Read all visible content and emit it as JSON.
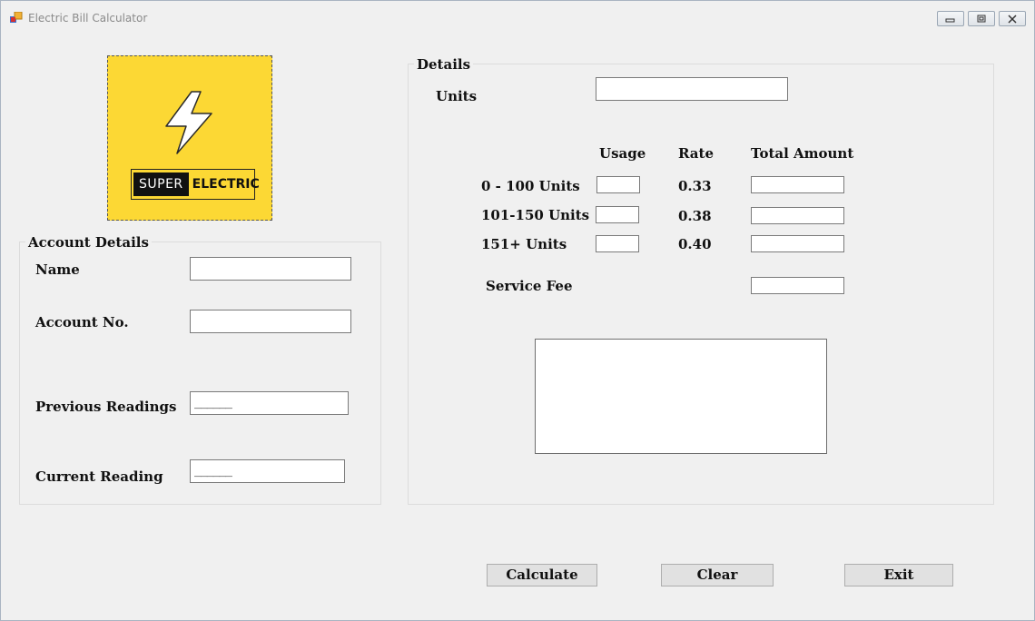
{
  "window": {
    "title": "Electric Bill Calculator"
  },
  "logo": {
    "word1": "SUPER",
    "word2": "ELECTRIC",
    "colors": {
      "background": "#fcd834",
      "badge": "#111111"
    }
  },
  "account": {
    "group_title": "Account Details",
    "name_label": "Name",
    "name_value": "",
    "account_label": "Account No.",
    "account_value": "",
    "previous_label": "Previous Readings",
    "previous_mask": "______",
    "current_label": "Current Reading",
    "current_mask": "______"
  },
  "details": {
    "group_title": "Details",
    "units_label": "Units",
    "units_value": "",
    "headers": {
      "usage": "Usage",
      "rate": "Rate",
      "total": "Total Amount"
    },
    "tiers": [
      {
        "label": "0 - 100 Units",
        "rate": "0.33",
        "usage": "",
        "total": ""
      },
      {
        "label": "101-150 Units",
        "rate": "0.38",
        "usage": "",
        "total": ""
      },
      {
        "label": "151+ Units",
        "rate": "0.40",
        "usage": "",
        "total": ""
      }
    ],
    "service_fee_label": "Service Fee",
    "service_fee_value": ""
  },
  "buttons": {
    "calculate": "Calculate",
    "clear": "Clear",
    "exit": "Exit"
  }
}
